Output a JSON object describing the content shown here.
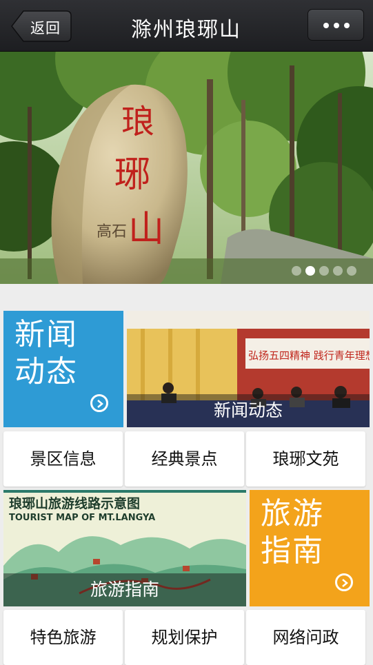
{
  "navbar": {
    "back_label": "返回",
    "title": "滁州琅琊山"
  },
  "hero": {
    "rock_text": "琅琊山",
    "signature": "高石",
    "pager": {
      "count": 5,
      "active_index": 1
    }
  },
  "tiles": {
    "news": {
      "label": "新闻动态",
      "caption": "新闻动态"
    },
    "nav_row_1": [
      "景区信息",
      "经典景点",
      "琅琊文苑"
    ],
    "map": {
      "title_cn": "琅琊山旅游线路示意图",
      "title_en": "TOURIST MAP OF MT.LANGYA",
      "caption": "旅游指南"
    },
    "guide": {
      "label": "旅游指南"
    },
    "nav_row_2": [
      "特色旅游",
      "规划保护",
      "网络问政"
    ]
  },
  "banner_text": "弘扬五四精神 践行青年理想”基层",
  "colors": {
    "news_tile": "#2e9bd5",
    "guide_tile": "#f3a31b",
    "navbar": "#1d1e21"
  },
  "icons": [
    "back-arrow-icon",
    "more-dots-icon",
    "chevron-right-circle-icon"
  ]
}
